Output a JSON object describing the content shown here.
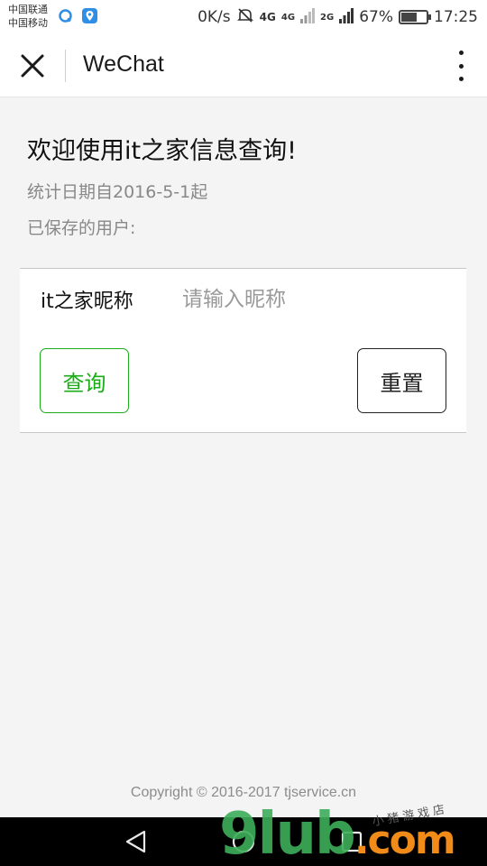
{
  "status_bar": {
    "carrier_1": "中国联通",
    "carrier_2": "中国移动",
    "net_speed": "0K/s",
    "net_4g_a": "4G",
    "net_4g_b": "4G",
    "net_2g": "2G",
    "battery": "67%",
    "battery_level": 0.67,
    "time": "17:25"
  },
  "header": {
    "title": "WeChat",
    "close_icon": "close-icon",
    "more_icon": "more-vertical-icon"
  },
  "content": {
    "welcome": "欢迎使用it之家信息查询!",
    "stat_date": "统计日期自2016-5-1起",
    "saved_users": "已保存的用户:"
  },
  "form": {
    "nickname_label": "it之家昵称",
    "nickname_value": "",
    "nickname_placeholder": "请输入昵称",
    "query_label": "查询",
    "reset_label": "重置"
  },
  "footer": {
    "copyright": "Copyright © 2016-2017 tjservice.cn"
  },
  "watermark": {
    "main": "9lub",
    "dot": ".com",
    "sub": "小猪游戏店"
  },
  "colors": {
    "accent_green": "#1aad19",
    "watermark_green": "#3cae5a",
    "watermark_orange": "#f08a18"
  }
}
